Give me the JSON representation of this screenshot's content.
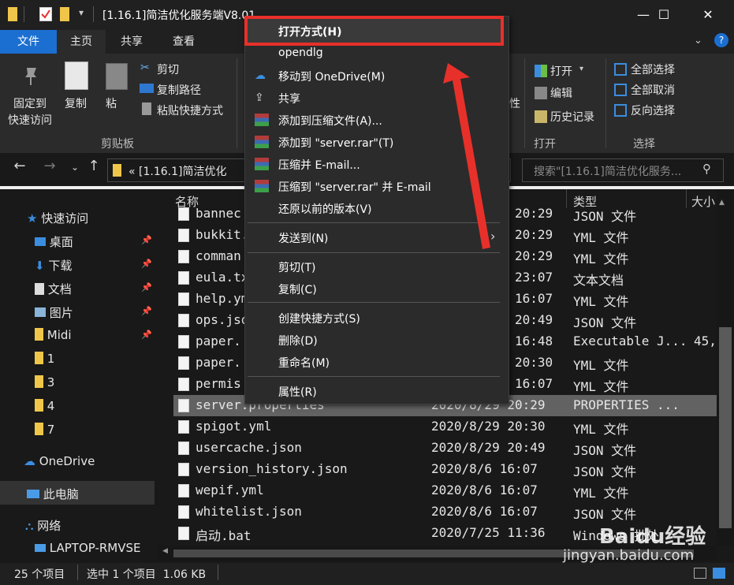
{
  "window": {
    "title": "[1.16.1]简洁优化服务端V8.01",
    "minimize_glyph": "—",
    "maximize_glyph": "☐",
    "close_glyph": "✕"
  },
  "ribbon_tabs": {
    "file": "文件",
    "home": "主页",
    "share": "共享",
    "view": "查看"
  },
  "ribbon": {
    "pin_line1": "固定到",
    "pin_line2": "快速访问",
    "copy": "复制",
    "paste": "粘",
    "cut": "剪切",
    "copy_path": "复制路径",
    "paste_shortcut": "粘贴快捷方式",
    "group_clipboard": "剪贴板",
    "property_fragment": "性",
    "open": "打开",
    "edit": "编辑",
    "history": "历史记录",
    "group_open": "打开",
    "select_all": "全部选择",
    "select_none": "全部取消",
    "invert_selection": "反向选择",
    "group_select": "选择"
  },
  "address": {
    "path": "« [1.16.1]简洁优化",
    "search_placeholder": "搜索\"[1.16.1]简洁优化服务..."
  },
  "navpane": {
    "quick_access": "快速访问",
    "desktop": "桌面",
    "downloads": "下载",
    "documents": "文档",
    "pictures": "图片",
    "midi": "Midi",
    "f1": "1",
    "f3": "3",
    "f4": "4",
    "f7": "7",
    "onedrive": "OneDrive",
    "this_pc": "此电脑",
    "network": "网络",
    "laptop": "LAPTOP-RMVSE"
  },
  "columns": {
    "name": "名称",
    "type": "类型",
    "size": "大小"
  },
  "files": [
    {
      "name": "bannec",
      "date": "20:29",
      "type": "JSON 文件",
      "size": ""
    },
    {
      "name": "bukkit.y",
      "date": "20:29",
      "type": "YML 文件",
      "size": ""
    },
    {
      "name": "comman",
      "date": "20:29",
      "type": "YML 文件",
      "size": ""
    },
    {
      "name": "eula.tx",
      "date": "23:07",
      "type": "文本文档",
      "size": ""
    },
    {
      "name": "help.ym",
      "date": "16:07",
      "type": "YML 文件",
      "size": ""
    },
    {
      "name": "ops.jso",
      "date": "20:49",
      "type": "JSON 文件",
      "size": ""
    },
    {
      "name": "paper.",
      "date": "16:48",
      "type": "Executable J...",
      "size": "45,"
    },
    {
      "name": "paper.",
      "date": "20:30",
      "type": "YML 文件",
      "size": ""
    },
    {
      "name": "permis",
      "date": "16:07",
      "type": "YML 文件",
      "size": ""
    },
    {
      "name": "server.properties",
      "date": "2020/8/29 20:29",
      "type": "PROPERTIES ...",
      "size": ""
    },
    {
      "name": "spigot.yml",
      "date": "2020/8/29 20:30",
      "type": "YML 文件",
      "size": ""
    },
    {
      "name": "usercache.json",
      "date": "2020/8/29 20:49",
      "type": "JSON 文件",
      "size": ""
    },
    {
      "name": "version_history.json",
      "date": "2020/8/6 16:07",
      "type": "JSON 文件",
      "size": ""
    },
    {
      "name": "wepif.yml",
      "date": "2020/8/6 16:07",
      "type": "YML 文件",
      "size": ""
    },
    {
      "name": "whitelist.json",
      "date": "2020/8/6 16:07",
      "type": "JSON 文件",
      "size": ""
    },
    {
      "name": "启动.bat",
      "date": "2020/7/25 11:36",
      "type": "Windows 批处",
      "size": ""
    }
  ],
  "context_menu": {
    "open_with": "打开方式(H)",
    "opendlg": "opendlg",
    "move_onedrive": "移动到 OneDrive(M)",
    "share": "共享",
    "add_archive": "添加到压缩文件(A)...",
    "add_rar": "添加到 \"server.rar\"(T)",
    "compress_email": "压缩并 E-mail...",
    "compress_rar_email": "压缩到 \"server.rar\" 并 E-mail",
    "restore_versions": "还原以前的版本(V)",
    "send_to": "发送到(N)",
    "cut": "剪切(T)",
    "copy": "复制(C)",
    "create_shortcut": "创建快捷方式(S)",
    "delete": "删除(D)",
    "rename": "重命名(M)",
    "properties": "属性(R)"
  },
  "status": {
    "item_count": "25 个项目",
    "selected": "选中 1 个项目  1.06 KB"
  },
  "watermark": {
    "brand": "Baidu经验",
    "url": "jingyan.baidu.com"
  },
  "colors": {
    "highlight": "#e8302a",
    "selection": "#626262",
    "folder": "#f0c64a"
  }
}
